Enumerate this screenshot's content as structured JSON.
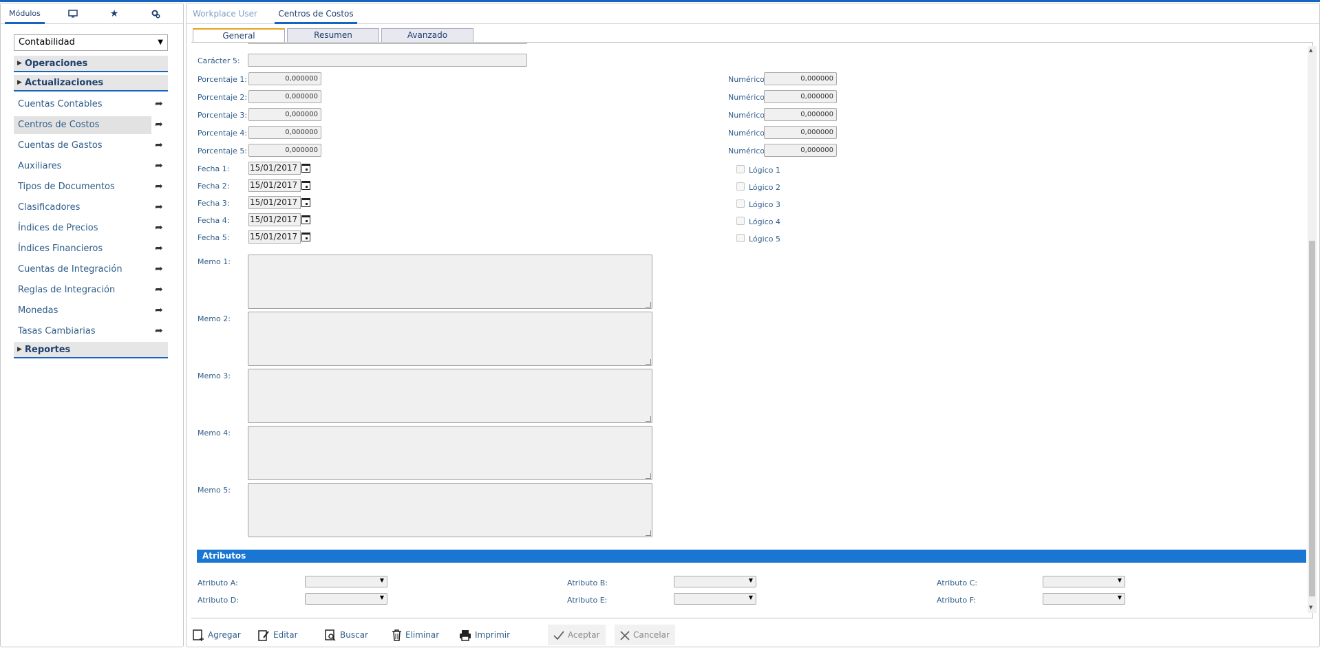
{
  "sidebar": {
    "tabs": {
      "modulos": "Módulos"
    },
    "module_select": "Contabilidad",
    "headers": [
      "Operaciones",
      "Actualizaciones",
      "Reportes"
    ],
    "items": [
      {
        "label": "Cuentas Contables"
      },
      {
        "label": "Centros de Costos",
        "selected": true
      },
      {
        "label": "Cuentas de Gastos"
      },
      {
        "label": "Auxiliares"
      },
      {
        "label": "Tipos de Documentos"
      },
      {
        "label": "Clasificadores"
      },
      {
        "label": "Índices de Precios"
      },
      {
        "label": "Índices Financieros"
      },
      {
        "label": "Cuentas de Integración"
      },
      {
        "label": "Reglas de Integración"
      },
      {
        "label": "Monedas"
      },
      {
        "label": "Tasas Cambiarias"
      }
    ]
  },
  "main": {
    "tabs": [
      "Workplace User",
      "Centros de Costos"
    ],
    "subtabs": [
      "General",
      "Resumen",
      "Avanzado"
    ],
    "caracter5_label": "Carácter 5:",
    "porcentajes": [
      {
        "label": "Porcentaje 1:",
        "value": "0,000000"
      },
      {
        "label": "Porcentaje 2:",
        "value": "0,000000"
      },
      {
        "label": "Porcentaje 3:",
        "value": "0,000000"
      },
      {
        "label": "Porcentaje 4:",
        "value": "0,000000"
      },
      {
        "label": "Porcentaje 5:",
        "value": "0,000000"
      }
    ],
    "numericos": [
      {
        "label": "Numérico 1:",
        "value": "0,000000"
      },
      {
        "label": "Numérico 2:",
        "value": "0,000000"
      },
      {
        "label": "Numérico 3:",
        "value": "0,000000"
      },
      {
        "label": "Numérico 4:",
        "value": "0,000000"
      },
      {
        "label": "Numérico 5:",
        "value": "0,000000"
      }
    ],
    "fechas": [
      {
        "label": "Fecha 1:",
        "value": "15/01/2017"
      },
      {
        "label": "Fecha 2:",
        "value": "15/01/2017"
      },
      {
        "label": "Fecha 3:",
        "value": "15/01/2017"
      },
      {
        "label": "Fecha 4:",
        "value": "15/01/2017"
      },
      {
        "label": "Fecha 5:",
        "value": "15/01/2017"
      }
    ],
    "logicos": [
      "Lógico 1",
      "Lógico 2",
      "Lógico 3",
      "Lógico 4",
      "Lógico 5"
    ],
    "memos": [
      "Memo 1:",
      "Memo 2:",
      "Memo 3:",
      "Memo 4:",
      "Memo 5:"
    ],
    "atributos_header": "Atributos",
    "atributos": [
      "Atributo A:",
      "Atributo B:",
      "Atributo C:",
      "Atributo D:",
      "Atributo E:",
      "Atributo F:"
    ]
  },
  "toolbar": {
    "agregar": "Agregar",
    "editar": "Editar",
    "buscar": "Buscar",
    "eliminar": "Eliminar",
    "imprimir": "Imprimir",
    "aceptar": "Aceptar",
    "cancelar": "Cancelar"
  },
  "colors": {
    "accent": "#1565c0",
    "attr_bar": "#1976d2",
    "active_subtab": "#e8a020"
  }
}
